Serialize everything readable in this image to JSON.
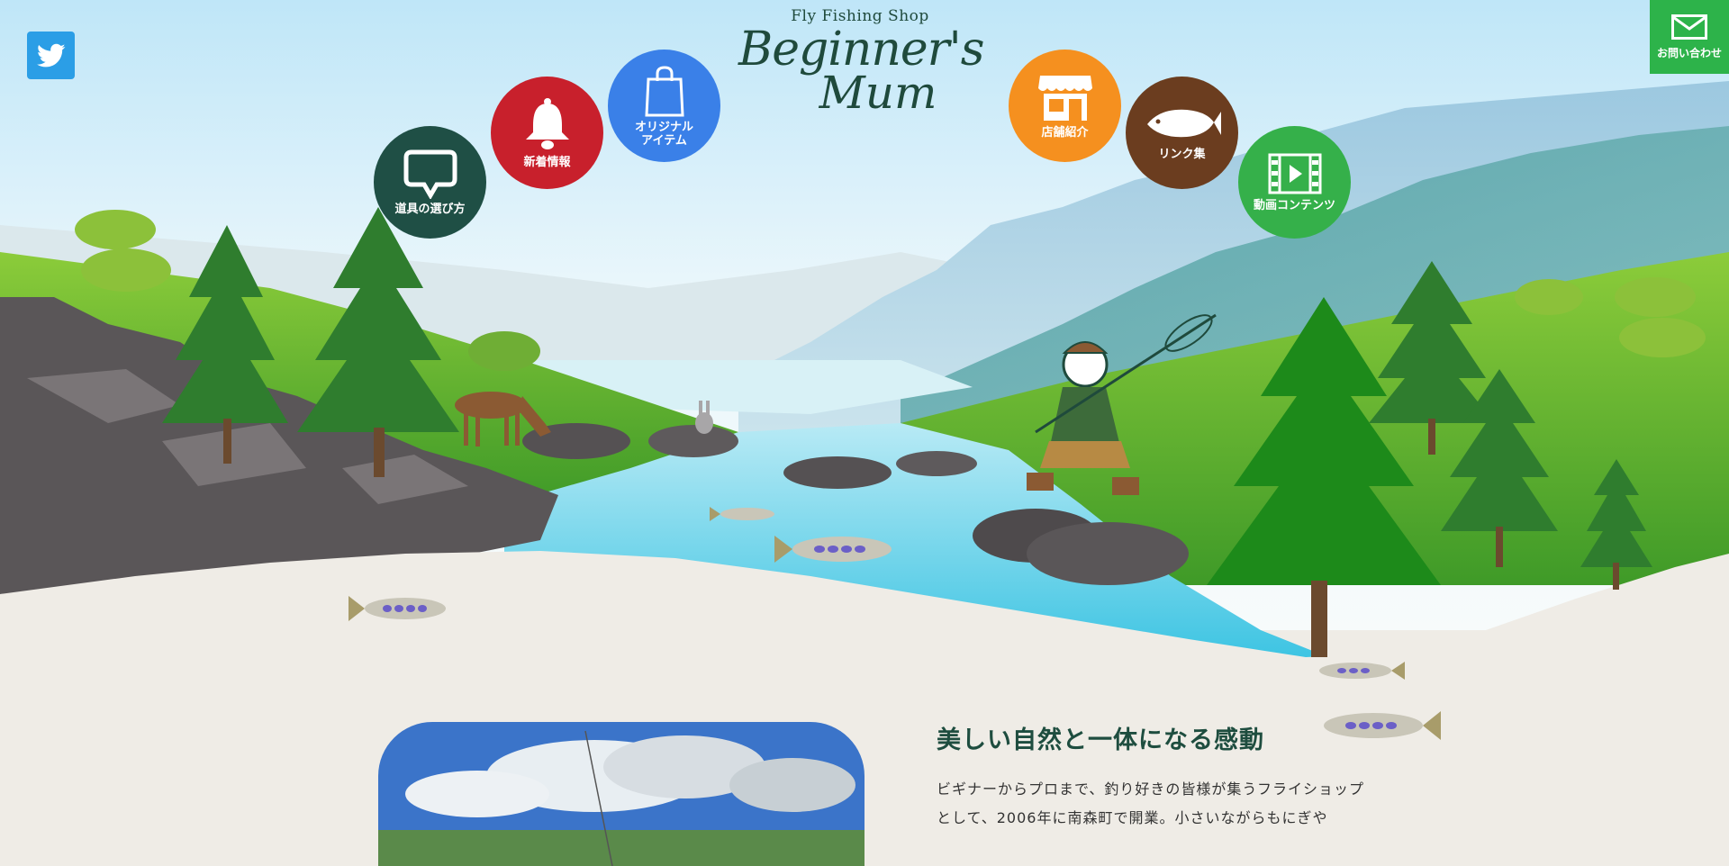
{
  "header": {
    "logo_subtitle": "Fly Fishing Shop",
    "logo_line1": "Beginner's",
    "logo_line2": "Mum"
  },
  "social": {
    "twitter_icon": "twitter-icon"
  },
  "contact": {
    "label": "お問い合わせ",
    "icon": "envelope-icon",
    "color": "#2db34a"
  },
  "nav": {
    "tools": {
      "label": "道具の選び方",
      "icon": "speech-bubble-icon",
      "color": "#1f4f45"
    },
    "news": {
      "label": "新着情報",
      "icon": "bell-icon",
      "color": "#c8202c"
    },
    "items": {
      "label": "オリジナル\nアイテム",
      "icon": "shopping-bag-icon",
      "color": "#3a80e8"
    },
    "shop": {
      "label": "店舗紹介",
      "icon": "storefront-icon",
      "color": "#f5901f"
    },
    "links": {
      "label": "リンク集",
      "icon": "fish-icon",
      "color": "#6b3d1f"
    },
    "videos": {
      "label": "動画コンテンツ",
      "icon": "film-play-icon",
      "color": "#35b04a"
    }
  },
  "main": {
    "heading": "美しい自然と一体になる感動",
    "text": "ビギナーからプロまで、釣り好きの皆様が集うフライショップとして、2006年に南森町で開業。小さいながらもにぎや"
  }
}
